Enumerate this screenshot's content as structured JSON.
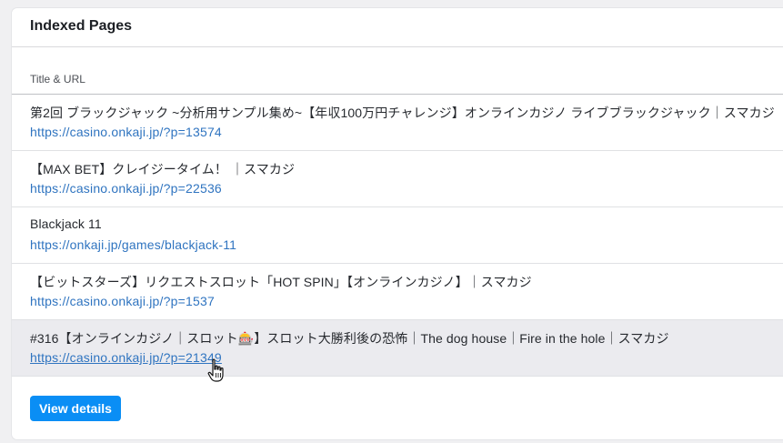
{
  "card": {
    "title": "Indexed Pages",
    "column_header": "Title & URL"
  },
  "rows": [
    {
      "title": "第2回 ブラックジャック ~分析用サンプル集め~【年収100万円チャレンジ】オンラインカジノ ライブブラックジャック｜スマカジ",
      "url": "https://casino.onkaji.jp/?p=13574"
    },
    {
      "title": "【MAX BET】クレイジータイム！ ｜スマカジ",
      "url": "https://casino.onkaji.jp/?p=22536"
    },
    {
      "title": "Blackjack 11",
      "url": "https://onkaji.jp/games/blackjack-11"
    },
    {
      "title": "【ビットスターズ】リクエストスロット「HOT SPIN」【オンラインカジノ】｜スマカジ",
      "url": "https://casino.onkaji.jp/?p=1537"
    },
    {
      "title": "#316【オンラインカジノ｜スロット🎰】スロット大勝利後の恐怖｜The dog house｜Fire in the hole｜スマカジ",
      "url": "https://casino.onkaji.jp/?p=21349"
    }
  ],
  "footer": {
    "view_details_label": "View details"
  },
  "colors": {
    "link": "#2f74c0",
    "button": "#0a8ef5",
    "hover_row": "#ebebef"
  },
  "cursor": "hand-pointer-icon"
}
